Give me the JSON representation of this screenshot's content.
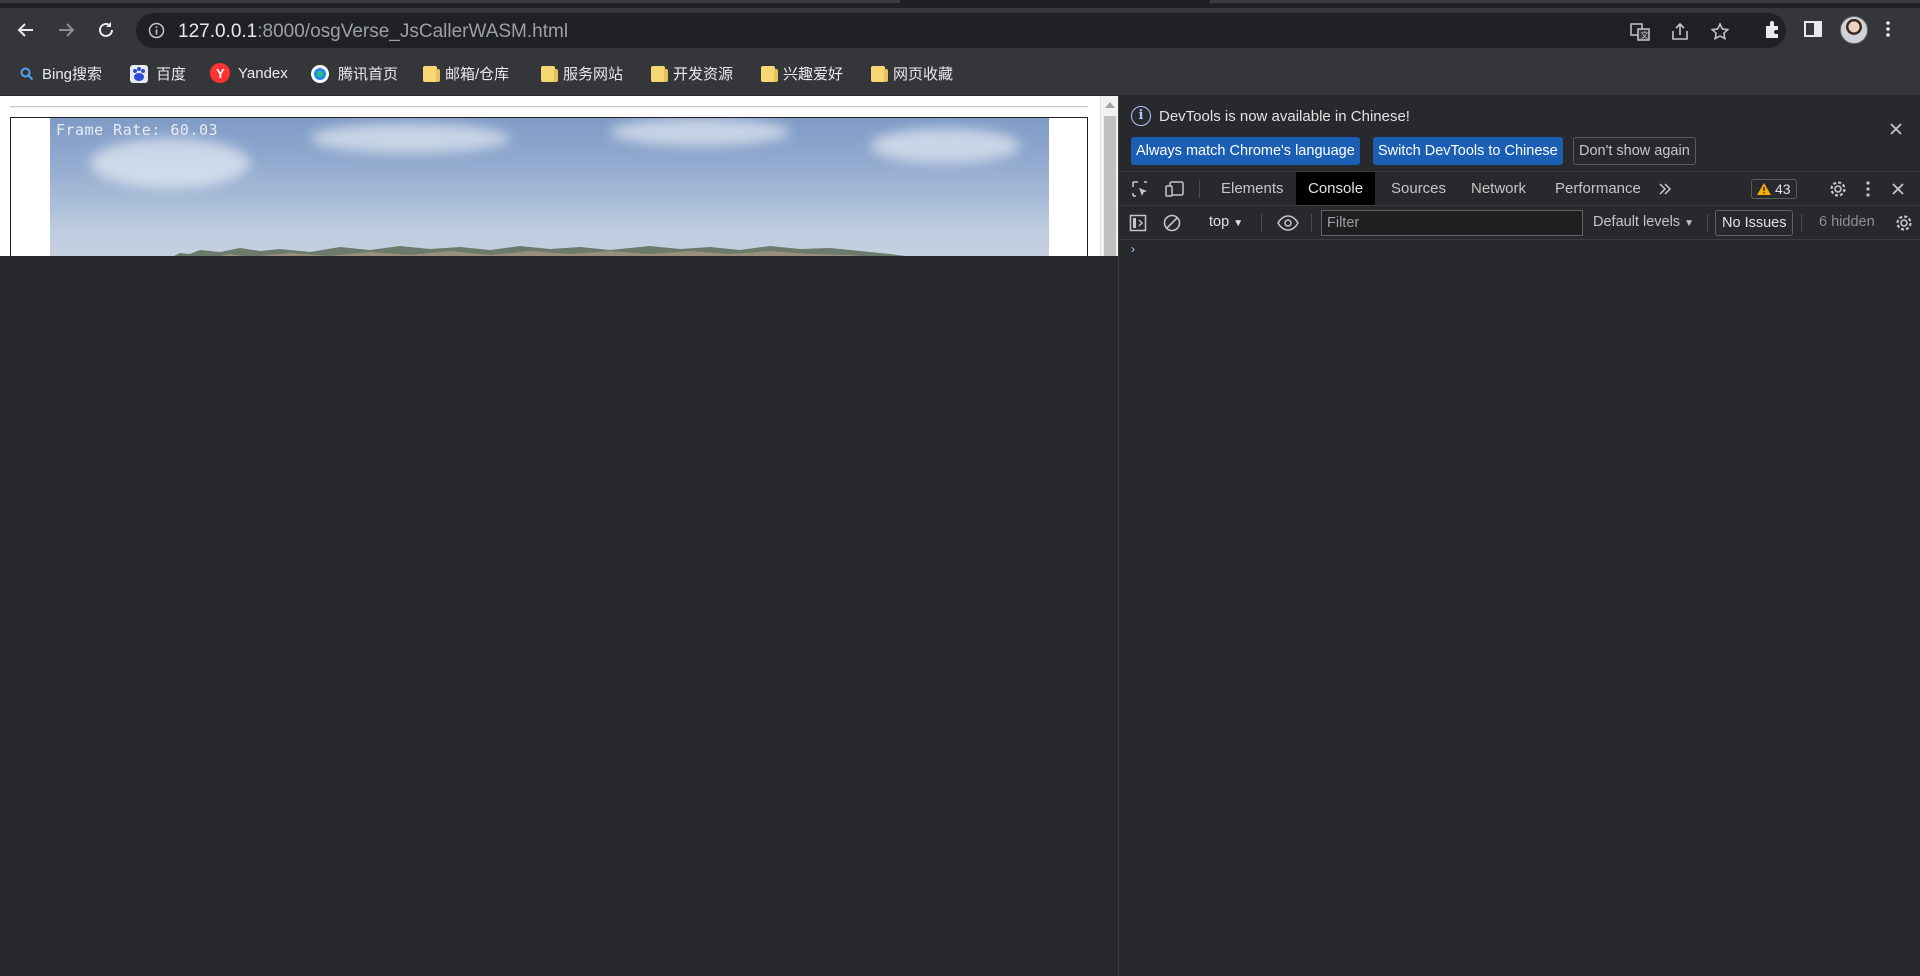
{
  "browser": {
    "url_host": "127.0.0.1",
    "url_rest": ":8000/osgVerse_JsCallerWASM.html"
  },
  "bookmarks": [
    {
      "label": "Bing搜索",
      "icon": "search-icon"
    },
    {
      "label": "百度",
      "icon": "baidu-icon"
    },
    {
      "label": "Yandex",
      "icon": "yandex-icon"
    },
    {
      "label": "腾讯首页",
      "icon": "tencent-icon"
    },
    {
      "label": "邮箱/仓库",
      "icon": "folder-icon"
    },
    {
      "label": "服务网站",
      "icon": "folder-icon"
    },
    {
      "label": "开发资源",
      "icon": "folder-icon"
    },
    {
      "label": "兴趣爱好",
      "icon": "folder-icon"
    },
    {
      "label": "网页收藏",
      "icon": "folder-icon"
    }
  ],
  "page": {
    "frame_rate": "Frame Rate: 60.03"
  },
  "devtools": {
    "banner_message": "DevTools is now available in Chinese!",
    "btn_always_match": "Always match Chrome's language",
    "btn_switch": "Switch DevTools to Chinese",
    "btn_dont_show": "Don't show again",
    "tabs": [
      "Elements",
      "Console",
      "Sources",
      "Network",
      "Performance"
    ],
    "active_tab": "Console",
    "warnings_count": "43",
    "context": "top",
    "filter_placeholder": "Filter",
    "levels": "Default levels",
    "issues": "No Issues",
    "hidden": "6 hidden",
    "colors": {
      "primary_button": "#1a5fb4",
      "active_tab_bg": "#000000",
      "warning": "#f9ab00"
    }
  }
}
